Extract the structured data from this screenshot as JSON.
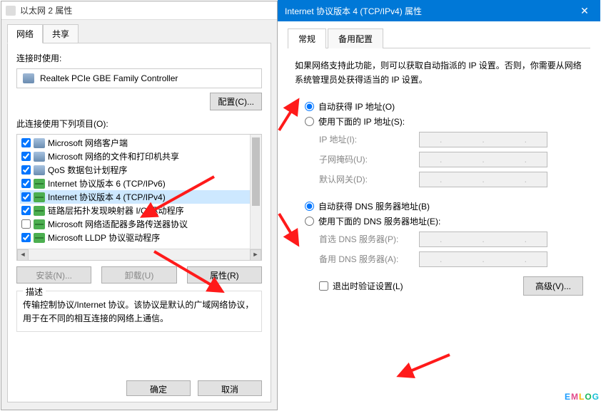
{
  "left": {
    "title": "以太网 2 属性",
    "tabs": {
      "network": "网络",
      "share": "共享"
    },
    "connect_label": "连接时使用:",
    "adapter": "Realtek PCIe GBE Family Controller",
    "configure_btn": "配置(C)...",
    "use_items_label": "此连接使用下列项目(O):",
    "items": [
      {
        "checked": true,
        "icon": "net",
        "label": "Microsoft 网络客户端"
      },
      {
        "checked": true,
        "icon": "net",
        "label": "Microsoft 网络的文件和打印机共享"
      },
      {
        "checked": true,
        "icon": "net",
        "label": "QoS 数据包计划程序"
      },
      {
        "checked": true,
        "icon": "proto",
        "label": "Internet 协议版本 6 (TCP/IPv6)"
      },
      {
        "checked": true,
        "icon": "proto",
        "label": "Internet 协议版本 4 (TCP/IPv4)",
        "selected": true
      },
      {
        "checked": true,
        "icon": "proto",
        "label": "链路层拓扑发现映射器 I/O 驱动程序"
      },
      {
        "checked": false,
        "icon": "proto",
        "label": "Microsoft 网络适配器多路传送器协议"
      },
      {
        "checked": true,
        "icon": "proto",
        "label": "Microsoft LLDP 协议驱动程序"
      }
    ],
    "install_btn": "安装(N)...",
    "uninstall_btn": "卸载(U)",
    "props_btn": "属性(R)",
    "desc_label": "描述",
    "desc_text": "传输控制协议/Internet 协议。该协议是默认的广域网络协议，用于在不同的相互连接的网络上通信。",
    "ok_btn": "确定",
    "cancel_btn": "取消"
  },
  "right": {
    "title": "Internet 协议版本 4 (TCP/IPv4) 属性",
    "close": "✕",
    "tabs": {
      "general": "常规",
      "alt": "备用配置"
    },
    "info": "如果网络支持此功能，则可以获取自动指派的 IP 设置。否则，你需要从网络系统管理员处获得适当的 IP 设置。",
    "ip": {
      "auto": "自动获得 IP 地址(O)",
      "manual": "使用下面的 IP 地址(S):",
      "addr": "IP 地址(I):",
      "mask": "子网掩码(U):",
      "gateway": "默认网关(D):"
    },
    "dns": {
      "auto": "自动获得 DNS 服务器地址(B)",
      "manual": "使用下面的 DNS 服务器地址(E):",
      "primary": "首选 DNS 服务器(P):",
      "alt": "备用 DNS 服务器(A):"
    },
    "validate": "退出时验证设置(L)",
    "advanced_btn": "高级(V)...",
    "logo": "EMLOG"
  }
}
